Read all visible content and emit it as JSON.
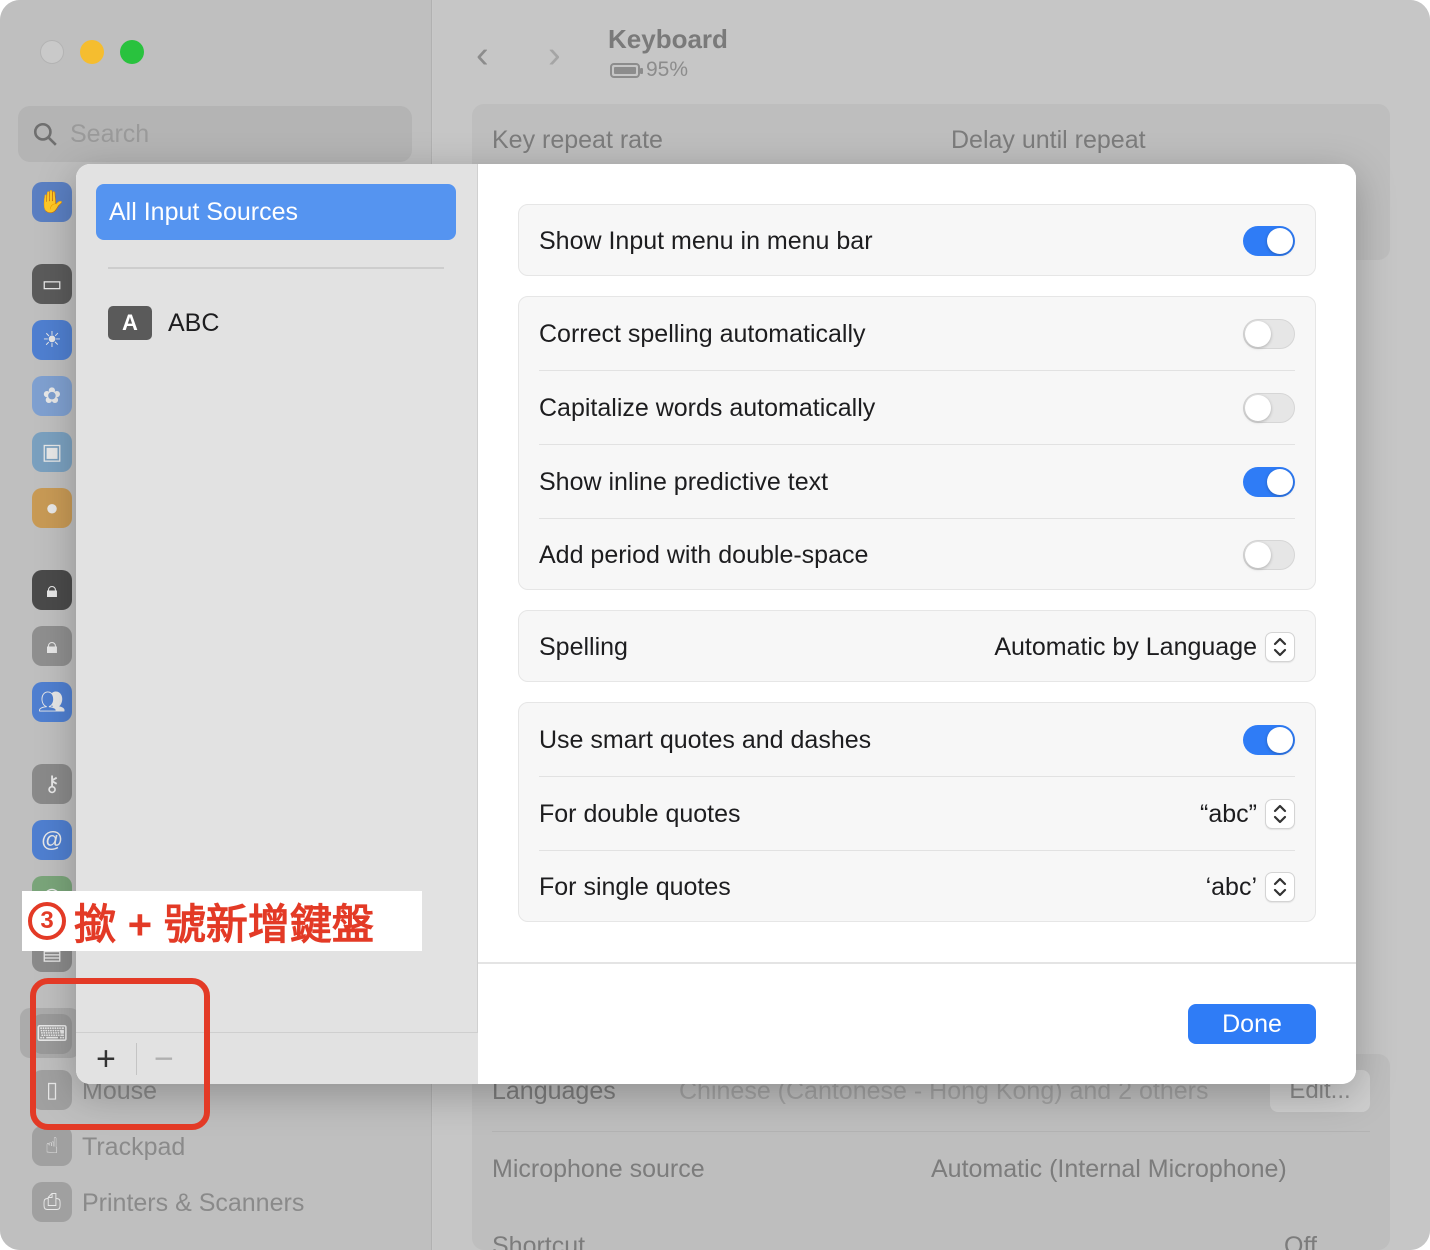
{
  "window": {
    "title": "Keyboard",
    "battery_text": "95%"
  },
  "sidebar": {
    "search_placeholder": "Search",
    "items": [
      {
        "label": "Mouse",
        "icon": "mouse-icon"
      },
      {
        "label": "Trackpad",
        "icon": "trackpad-icon"
      },
      {
        "label": "Printers & Scanners",
        "icon": "printer-icon"
      }
    ]
  },
  "background": {
    "key_repeat_label": "Key repeat rate",
    "delay_label": "Delay until repeat",
    "languages_label": "Languages",
    "languages_value": "Chinese (Cantonese - Hong Kong) and 2 others",
    "edit_button": "Edit...",
    "microphone_label": "Microphone source",
    "microphone_value": "Automatic (Internal Microphone)",
    "shortcut_label": "Shortcut",
    "shortcut_value": "Off"
  },
  "sheet": {
    "left": {
      "selected_label": "All Input Sources",
      "sources": [
        {
          "badge": "A",
          "label": "ABC"
        }
      ],
      "add_button": "+",
      "remove_button": "−"
    },
    "settings": {
      "show_input_menu": {
        "label": "Show Input menu in menu bar",
        "on": true
      },
      "correct_spelling": {
        "label": "Correct spelling automatically",
        "on": false
      },
      "capitalize_words": {
        "label": "Capitalize words automatically",
        "on": false
      },
      "inline_predictive": {
        "label": "Show inline predictive text",
        "on": true
      },
      "add_period": {
        "label": "Add period with double-space",
        "on": false
      },
      "spelling": {
        "label": "Spelling",
        "value": "Automatic by Language"
      },
      "smart_quotes": {
        "label": "Use smart quotes and dashes",
        "on": true
      },
      "double_quotes": {
        "label": "For double quotes",
        "value": "“abc”"
      },
      "single_quotes": {
        "label": "For single quotes",
        "value": "‘abc’"
      }
    },
    "done_button": "Done"
  },
  "annotation": {
    "step": "3",
    "text": "撳 + 號新增鍵盤",
    "color": "#e33a26"
  },
  "colors": {
    "accent": "#2f7cf6",
    "selection": "#5594f0"
  }
}
